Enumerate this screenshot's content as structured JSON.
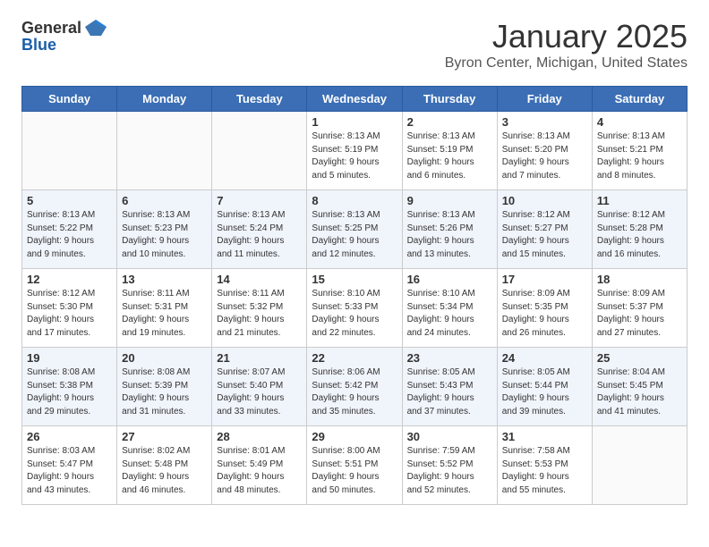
{
  "header": {
    "logo_general": "General",
    "logo_blue": "Blue",
    "month_year": "January 2025",
    "location": "Byron Center, Michigan, United States"
  },
  "days_of_week": [
    "Sunday",
    "Monday",
    "Tuesday",
    "Wednesday",
    "Thursday",
    "Friday",
    "Saturday"
  ],
  "weeks": [
    [
      {
        "day": "",
        "info": ""
      },
      {
        "day": "",
        "info": ""
      },
      {
        "day": "",
        "info": ""
      },
      {
        "day": "1",
        "info": "Sunrise: 8:13 AM\nSunset: 5:19 PM\nDaylight: 9 hours\nand 5 minutes."
      },
      {
        "day": "2",
        "info": "Sunrise: 8:13 AM\nSunset: 5:19 PM\nDaylight: 9 hours\nand 6 minutes."
      },
      {
        "day": "3",
        "info": "Sunrise: 8:13 AM\nSunset: 5:20 PM\nDaylight: 9 hours\nand 7 minutes."
      },
      {
        "day": "4",
        "info": "Sunrise: 8:13 AM\nSunset: 5:21 PM\nDaylight: 9 hours\nand 8 minutes."
      }
    ],
    [
      {
        "day": "5",
        "info": "Sunrise: 8:13 AM\nSunset: 5:22 PM\nDaylight: 9 hours\nand 9 minutes."
      },
      {
        "day": "6",
        "info": "Sunrise: 8:13 AM\nSunset: 5:23 PM\nDaylight: 9 hours\nand 10 minutes."
      },
      {
        "day": "7",
        "info": "Sunrise: 8:13 AM\nSunset: 5:24 PM\nDaylight: 9 hours\nand 11 minutes."
      },
      {
        "day": "8",
        "info": "Sunrise: 8:13 AM\nSunset: 5:25 PM\nDaylight: 9 hours\nand 12 minutes."
      },
      {
        "day": "9",
        "info": "Sunrise: 8:13 AM\nSunset: 5:26 PM\nDaylight: 9 hours\nand 13 minutes."
      },
      {
        "day": "10",
        "info": "Sunrise: 8:12 AM\nSunset: 5:27 PM\nDaylight: 9 hours\nand 15 minutes."
      },
      {
        "day": "11",
        "info": "Sunrise: 8:12 AM\nSunset: 5:28 PM\nDaylight: 9 hours\nand 16 minutes."
      }
    ],
    [
      {
        "day": "12",
        "info": "Sunrise: 8:12 AM\nSunset: 5:30 PM\nDaylight: 9 hours\nand 17 minutes."
      },
      {
        "day": "13",
        "info": "Sunrise: 8:11 AM\nSunset: 5:31 PM\nDaylight: 9 hours\nand 19 minutes."
      },
      {
        "day": "14",
        "info": "Sunrise: 8:11 AM\nSunset: 5:32 PM\nDaylight: 9 hours\nand 21 minutes."
      },
      {
        "day": "15",
        "info": "Sunrise: 8:10 AM\nSunset: 5:33 PM\nDaylight: 9 hours\nand 22 minutes."
      },
      {
        "day": "16",
        "info": "Sunrise: 8:10 AM\nSunset: 5:34 PM\nDaylight: 9 hours\nand 24 minutes."
      },
      {
        "day": "17",
        "info": "Sunrise: 8:09 AM\nSunset: 5:35 PM\nDaylight: 9 hours\nand 26 minutes."
      },
      {
        "day": "18",
        "info": "Sunrise: 8:09 AM\nSunset: 5:37 PM\nDaylight: 9 hours\nand 27 minutes."
      }
    ],
    [
      {
        "day": "19",
        "info": "Sunrise: 8:08 AM\nSunset: 5:38 PM\nDaylight: 9 hours\nand 29 minutes."
      },
      {
        "day": "20",
        "info": "Sunrise: 8:08 AM\nSunset: 5:39 PM\nDaylight: 9 hours\nand 31 minutes."
      },
      {
        "day": "21",
        "info": "Sunrise: 8:07 AM\nSunset: 5:40 PM\nDaylight: 9 hours\nand 33 minutes."
      },
      {
        "day": "22",
        "info": "Sunrise: 8:06 AM\nSunset: 5:42 PM\nDaylight: 9 hours\nand 35 minutes."
      },
      {
        "day": "23",
        "info": "Sunrise: 8:05 AM\nSunset: 5:43 PM\nDaylight: 9 hours\nand 37 minutes."
      },
      {
        "day": "24",
        "info": "Sunrise: 8:05 AM\nSunset: 5:44 PM\nDaylight: 9 hours\nand 39 minutes."
      },
      {
        "day": "25",
        "info": "Sunrise: 8:04 AM\nSunset: 5:45 PM\nDaylight: 9 hours\nand 41 minutes."
      }
    ],
    [
      {
        "day": "26",
        "info": "Sunrise: 8:03 AM\nSunset: 5:47 PM\nDaylight: 9 hours\nand 43 minutes."
      },
      {
        "day": "27",
        "info": "Sunrise: 8:02 AM\nSunset: 5:48 PM\nDaylight: 9 hours\nand 46 minutes."
      },
      {
        "day": "28",
        "info": "Sunrise: 8:01 AM\nSunset: 5:49 PM\nDaylight: 9 hours\nand 48 minutes."
      },
      {
        "day": "29",
        "info": "Sunrise: 8:00 AM\nSunset: 5:51 PM\nDaylight: 9 hours\nand 50 minutes."
      },
      {
        "day": "30",
        "info": "Sunrise: 7:59 AM\nSunset: 5:52 PM\nDaylight: 9 hours\nand 52 minutes."
      },
      {
        "day": "31",
        "info": "Sunrise: 7:58 AM\nSunset: 5:53 PM\nDaylight: 9 hours\nand 55 minutes."
      },
      {
        "day": "",
        "info": ""
      }
    ]
  ]
}
